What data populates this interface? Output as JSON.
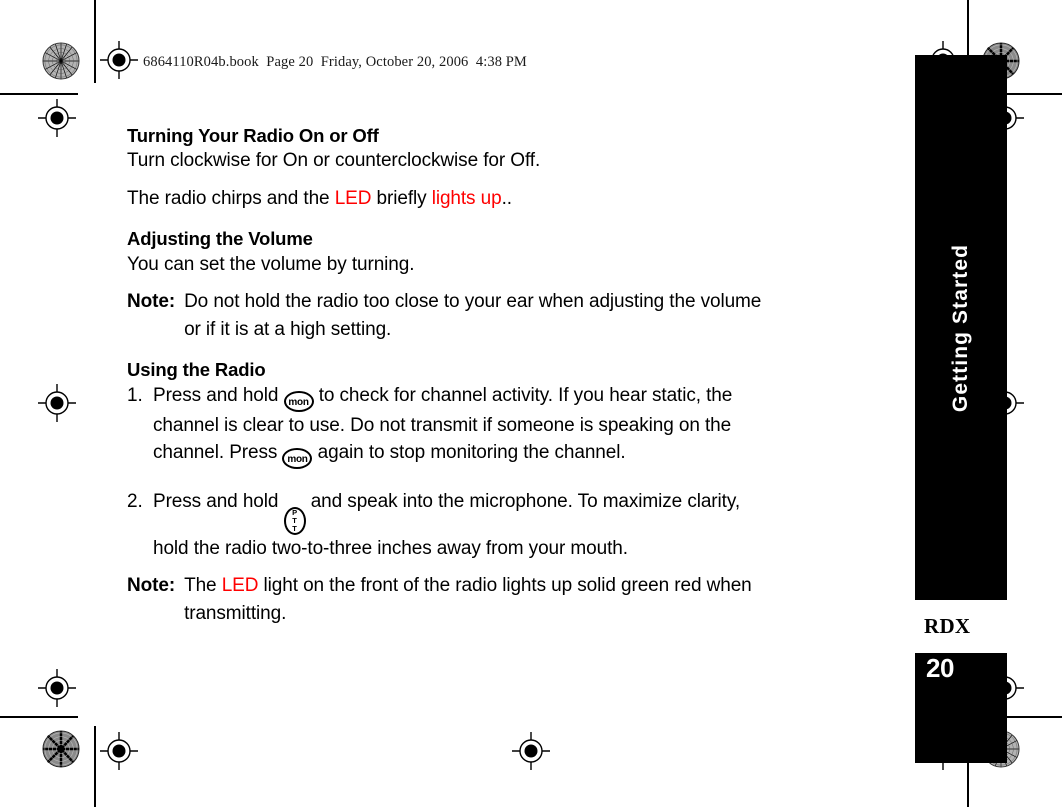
{
  "page": {
    "file_header": "6864110R04b.book  Page 20  Friday, October 20, 2006  4:38 PM",
    "page_number": "20",
    "accent_red": "#FF0000",
    "sidebar_bg": "#000000"
  },
  "sidebar": {
    "section_label": "Getting Started",
    "brand": "RDX"
  },
  "content": {
    "section1": {
      "heading": "Turning Your Radio On or Off",
      "line1": "Turn clockwise for On or counterclockwise for Off.",
      "line2_a": "The radio chirps and the ",
      "line2_led": "LED",
      "line2_b": " briefly ",
      "line2_red": "lights up",
      "line2_c": ".."
    },
    "section2": {
      "heading": "Adjusting the Volume",
      "line1": "You can set the volume by turning.",
      "note_label": "Note:",
      "note_body": "Do not hold the radio too close to your ear when adjusting the volume or if it is at a high setting."
    },
    "section3": {
      "heading": "Using the Radio",
      "steps": [
        {
          "number": "1.",
          "text_a": "Press and hold ",
          "icon1": "mon",
          "text_b": " to check for channel activity. If you hear static, the channel is clear to use. Do not transmit if someone is speaking on the channel. Press ",
          "icon2": "mon",
          "text_c": " again to stop monitoring the channel."
        },
        {
          "number": "2.",
          "text_a": "Press and hold ",
          "icon1": "ptt",
          "text_b": "  and speak into the microphone. To maximize clarity, hold the radio two-to-three inches away from your mouth.",
          "icon2": "",
          "text_c": ""
        }
      ],
      "note_label": "Note:",
      "note_a": "The ",
      "note_led": "LED",
      "note_b": " light on the front of the radio lights up solid green red when transmitting."
    }
  },
  "icons": {
    "mon_label": "mon",
    "ptt_p": "P",
    "ptt_t1": "T",
    "ptt_t2": "T"
  }
}
